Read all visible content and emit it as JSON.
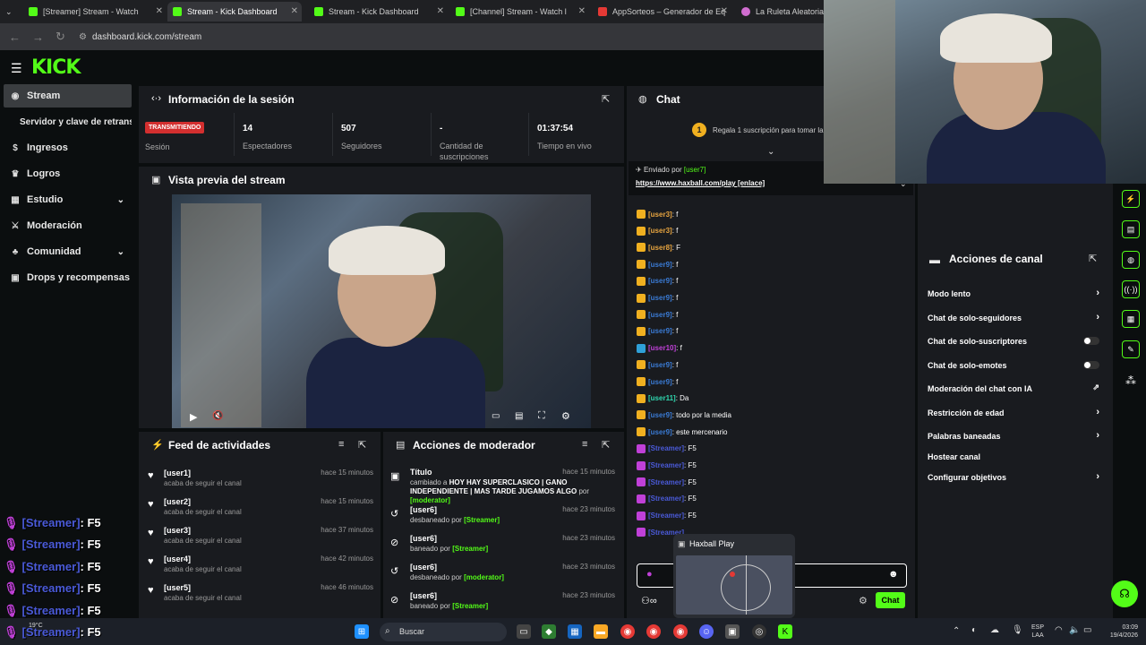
{
  "browser": {
    "tabs": [
      {
        "label": "[Streamer] Stream - Watch",
        "active": false
      },
      {
        "label": "Stream - Kick Dashboard",
        "active": true
      },
      {
        "label": "Stream - Kick Dashboard",
        "active": false
      },
      {
        "label": "[Channel] Stream - Watch l",
        "active": false
      },
      {
        "label": "AppSorteos – Generador de Eq",
        "active": false
      },
      {
        "label": "La Ruleta Aleatoria",
        "active": false
      }
    ],
    "url": "dashboard.kick.com/stream"
  },
  "logo": "KICK",
  "sidebar": {
    "items": [
      {
        "label": "Stream",
        "icon": "stream-icon",
        "active": true
      },
      {
        "label": "Servidor y clave de retransn",
        "icon": "",
        "active": false
      },
      {
        "label": "Ingresos",
        "icon": "dollar-icon",
        "active": false
      },
      {
        "label": "Logros",
        "icon": "trophy-icon",
        "active": false
      },
      {
        "label": "Estudio",
        "icon": "grid-icon",
        "active": false
      },
      {
        "label": "Moderación",
        "icon": "sword-icon",
        "active": false
      },
      {
        "label": "Comunidad",
        "icon": "users-icon",
        "active": false
      },
      {
        "label": "Drops y recompensas",
        "icon": "gift-icon",
        "active": false
      }
    ]
  },
  "session": {
    "title": "Información de la sesión",
    "status_badge": "TRANSMITIENDO",
    "stats": [
      {
        "value": "",
        "label": "Sesión"
      },
      {
        "value": "14",
        "label": "Espectadores"
      },
      {
        "value": "507",
        "label": "Seguidores"
      },
      {
        "value": "-",
        "label": "Cantidad de suscripciones"
      },
      {
        "value": "01:37:54",
        "label": "Tiempo en vivo"
      }
    ]
  },
  "preview": {
    "title": "Vista previa del stream"
  },
  "feed": {
    "title": "Feed de actividades",
    "items": [
      {
        "name": "[user1]",
        "sub": "acaba de seguir el canal",
        "time": "hace 15 minutos"
      },
      {
        "name": "[user2]",
        "sub": "acaba de seguir el canal",
        "time": "hace 15 minutos"
      },
      {
        "name": "[user3]",
        "sub": "acaba de seguir el canal",
        "time": "hace 37 minutos"
      },
      {
        "name": "[user4]",
        "sub": "acaba de seguir el canal",
        "time": "hace 42 minutos"
      },
      {
        "name": "[user5]",
        "sub": "acaba de seguir el canal",
        "time": "hace 46 minutos"
      }
    ]
  },
  "modactions": {
    "title": "Acciones de moderador",
    "items": [
      {
        "name": "Título",
        "pre": "cambiado a",
        "text": "HOY HAY SUPERCLASICO | GANO INDEPENDIENTE | MAS TARDE JUGAMOS ALGO",
        "by_pre": "por",
        "by": "[moderator]",
        "time": "hace 15 minutos"
      },
      {
        "name": "[user6]",
        "pre": "desbaneado",
        "text": "",
        "by_pre": "por",
        "by": "[Streamer]",
        "time": "hace 23 minutos"
      },
      {
        "name": "[user6]",
        "pre": "baneado",
        "text": "",
        "by_pre": "por",
        "by": "[Streamer]",
        "time": "hace 23 minutos"
      },
      {
        "name": "[user6]",
        "pre": "desbaneado",
        "text": "",
        "by_pre": "por",
        "by": "[moderator]",
        "time": "hace 23 minutos"
      },
      {
        "name": "[user6]",
        "pre": "baneado",
        "text": "",
        "by_pre": "por",
        "by": "[Streamer]",
        "time": "hace 23 minutos"
      }
    ]
  },
  "chat": {
    "title": "Chat",
    "sub_promo_count": "1",
    "sub_promo": "Regala 1 suscripción para tomar la p",
    "pinned_by_label": "Enviado por",
    "pinned_by": "[user7]",
    "pinned_link": "https://www.haxball.com/play [enlace]",
    "messages": [
      {
        "user": "[user3]",
        "text": ": f",
        "color": "#e8a540"
      },
      {
        "user": "[user3]",
        "text": ": f",
        "color": "#e8a540"
      },
      {
        "user": "[user8]",
        "text": ": F",
        "color": "#e8a540"
      },
      {
        "user": "[user9]",
        "text": ": f",
        "color": "#3a7bd5"
      },
      {
        "user": "[user9]",
        "text": ": f",
        "color": "#3a7bd5"
      },
      {
        "user": "[user9]",
        "text": ": f",
        "color": "#3a7bd5"
      },
      {
        "user": "[user9]",
        "text": ": f",
        "color": "#3a7bd5"
      },
      {
        "user": "[user9]",
        "text": ": f",
        "color": "#3a7bd5"
      },
      {
        "user": "[user10]",
        "text": ": f",
        "color": "#c040d8"
      },
      {
        "user": "[user9]",
        "text": ": f",
        "color": "#3a7bd5"
      },
      {
        "user": "[user9]",
        "text": ": f",
        "color": "#3a7bd5"
      },
      {
        "user": "[user11]",
        "text": ": Da",
        "color": "#2fd8b0"
      },
      {
        "user": "[user9]",
        "text": ": todo por la media",
        "color": "#3a7bd5"
      },
      {
        "user": "[user9]",
        "text": ": este mercenario",
        "color": "#3a7bd5"
      },
      {
        "user": "[Streamer]",
        "text": ": F5",
        "color": "#4a5ad8"
      },
      {
        "user": "[Streamer]",
        "text": ": F5",
        "color": "#4a5ad8"
      },
      {
        "user": "[Streamer]",
        "text": ": F5",
        "color": "#4a5ad8"
      },
      {
        "user": "[Streamer]",
        "text": ": F5",
        "color": "#4a5ad8"
      },
      {
        "user": "[Streamer]",
        "text": ": F5",
        "color": "#4a5ad8"
      },
      {
        "user": "[Streamer]",
        "text": "",
        "color": "#4a5ad8"
      }
    ],
    "send_button": "Chat"
  },
  "popup": {
    "label": "Haxball Play"
  },
  "channel_actions": {
    "title": "Acciones de canal",
    "items": [
      {
        "label": "Modo lento",
        "control": "chevron"
      },
      {
        "label": "Chat de solo-seguidores",
        "control": "chevron"
      },
      {
        "label": "Chat de solo-suscriptores",
        "control": "toggle"
      },
      {
        "label": "Chat de solo-emotes",
        "control": "toggle"
      },
      {
        "label": "Moderación del chat con IA",
        "control": "chart"
      },
      {
        "label": "Restricción de edad",
        "control": "chevron"
      },
      {
        "label": "Palabras baneadas",
        "control": "chevron"
      },
      {
        "label": "Hostear canal",
        "control": "none"
      },
      {
        "label": "Configurar objetivos",
        "control": "chevron"
      }
    ]
  },
  "overlay_chat": [
    {
      "user": "[Streamer]",
      "text": ": F5"
    },
    {
      "user": "[Streamer]",
      "text": ": F5"
    },
    {
      "user": "[Streamer]",
      "text": ": F5"
    },
    {
      "user": "[Streamer]",
      "text": ": F5"
    },
    {
      "user": "[Streamer]",
      "text": ": F5"
    },
    {
      "user": "[Streamer]",
      "text": ": F5"
    }
  ],
  "taskbar": {
    "search": "Buscar",
    "weather": "19°C",
    "lang_top": "ESP",
    "lang_bottom": "LAA",
    "time": "03:09",
    "date": "19/4/2026"
  },
  "colors": {
    "accent": "#53fc18",
    "panel": "#191b1f",
    "bg": "#0b0e0f",
    "live": "#d32f2f"
  }
}
